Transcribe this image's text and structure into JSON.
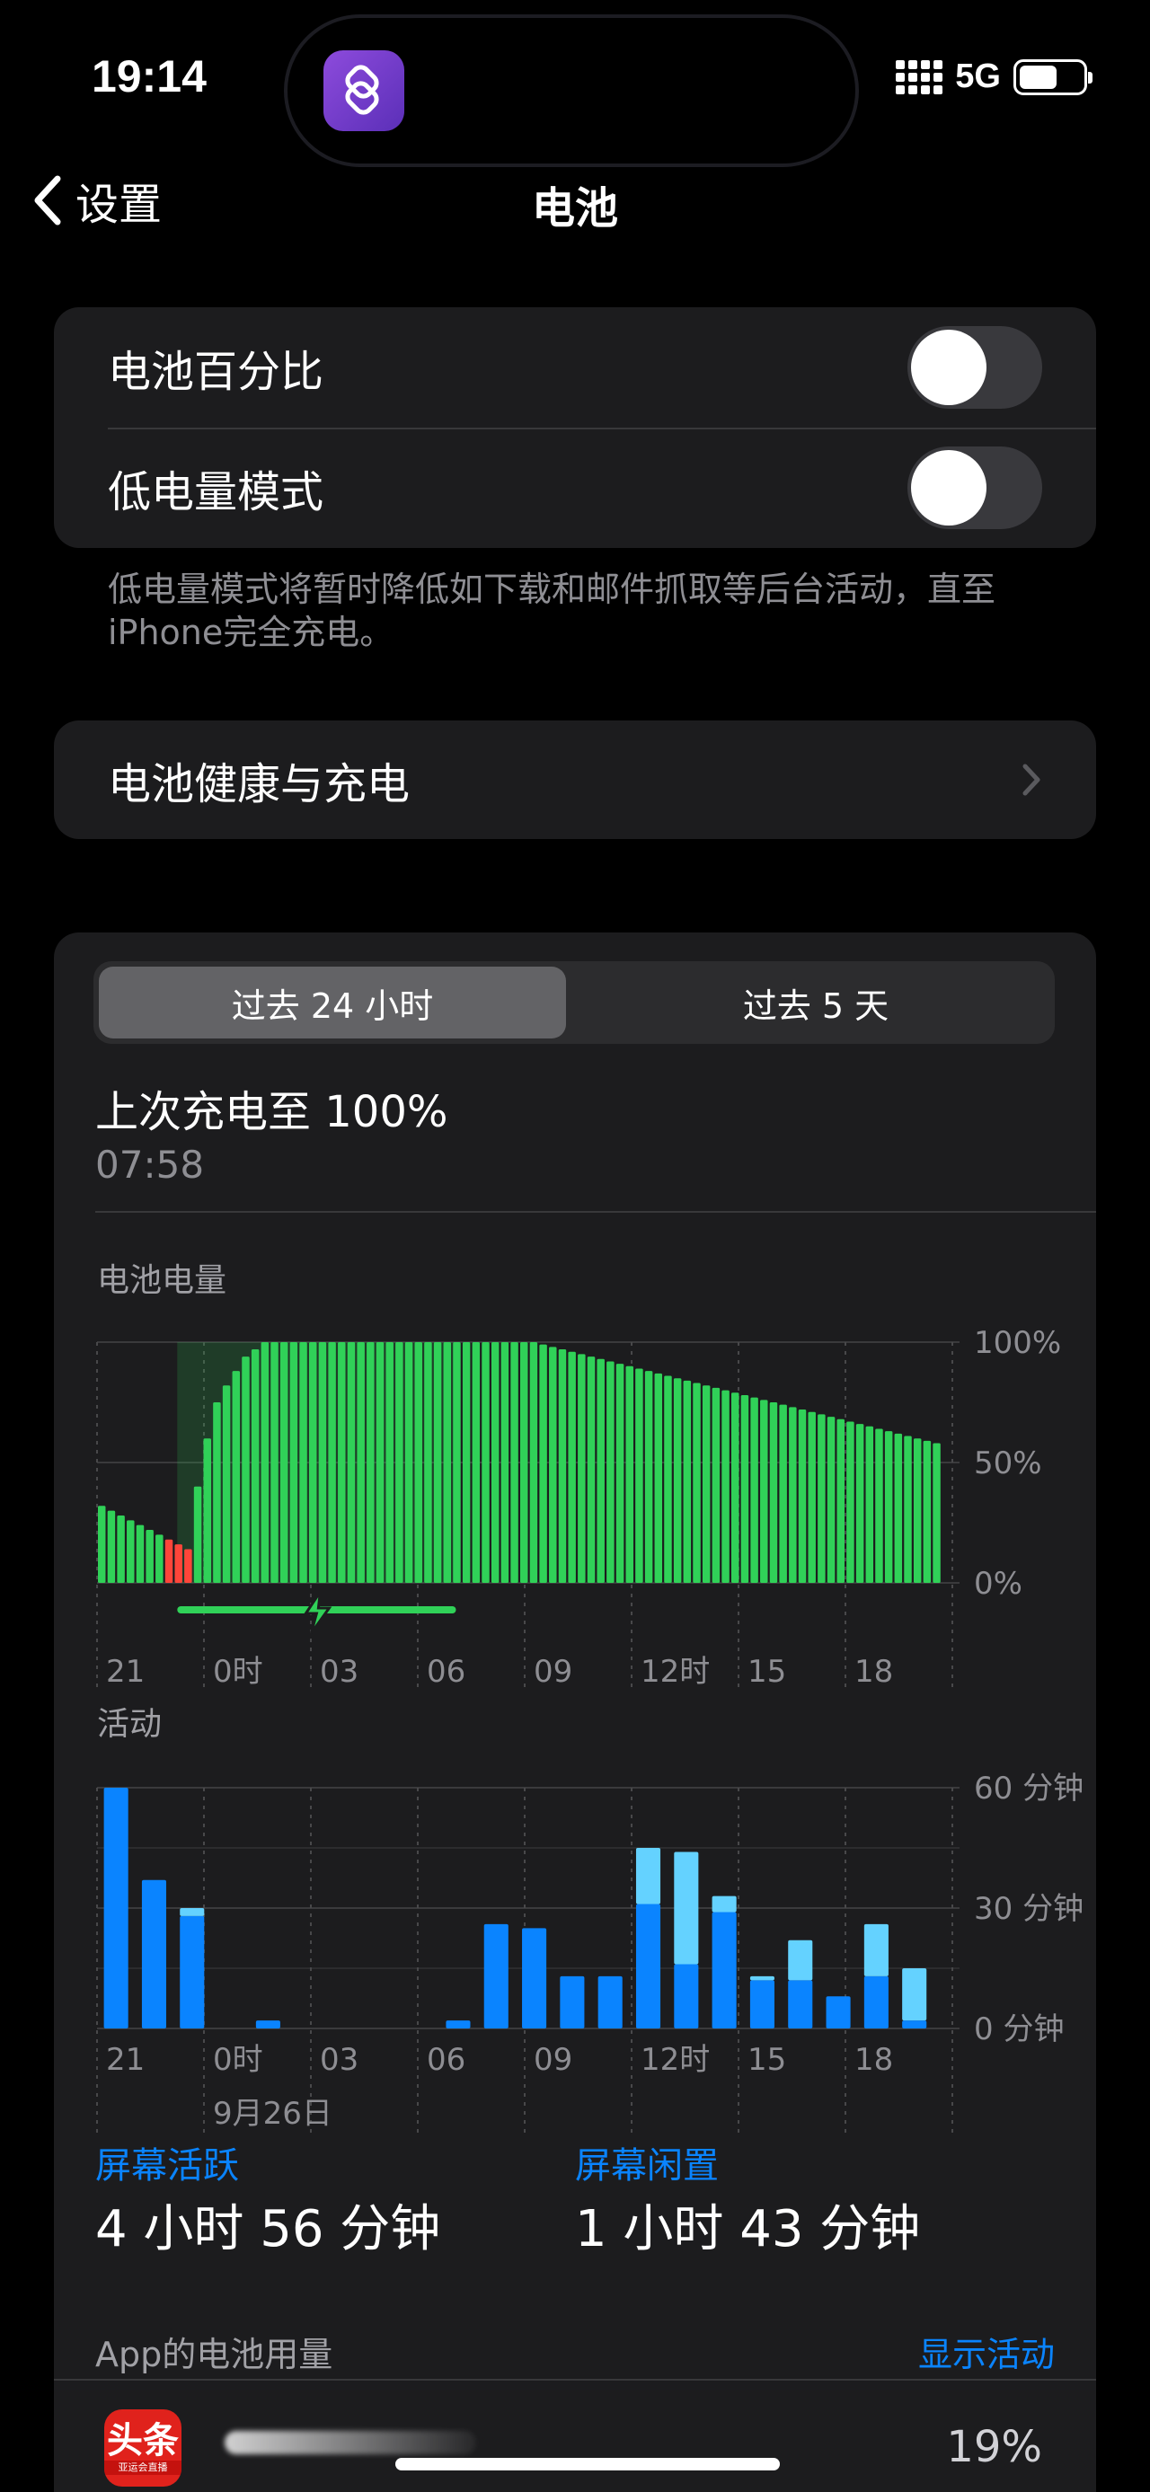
{
  "status_bar": {
    "time": "19:14",
    "network": "5G",
    "battery_level": 0.6
  },
  "nav": {
    "back_label": "设置",
    "title": "电池"
  },
  "settings": {
    "battery_percentage_label": "电池百分比",
    "battery_percentage_on": false,
    "low_power_label": "低电量模式",
    "low_power_on": false,
    "low_power_footnote": "低电量模式将暂时降低如下载和邮件抓取等后台活动，直至iPhone完全充电。",
    "health_label": "电池健康与充电"
  },
  "usage": {
    "segment_24h": "过去 24 小时",
    "segment_5d": "过去 5 天",
    "selected_segment": "过去 24 小时",
    "last_charged_title": "上次充电至 100%",
    "last_charged_time": "07:58",
    "battery_chart_label": "电池电量",
    "activity_chart_label": "活动",
    "date_label": "9月26日",
    "screen_on_label": "屏幕活跃",
    "screen_on_value": "4 小时 56 分钟",
    "screen_off_label": "屏幕闲置",
    "screen_off_value": "1 小时 43 分钟",
    "app_usage_label": "App的电池用量",
    "show_activity_label": "显示活动",
    "apps": [
      {
        "icon_text": "头条",
        "icon_subtext": "亚运会直播",
        "percent": "19%"
      }
    ]
  },
  "colors": {
    "battery_green": "#30d158",
    "battery_red": "#ff453a",
    "activity_on": "#0a84ff",
    "activity_off": "#64d2ff",
    "link_blue": "#0a84ff"
  },
  "chart_data": [
    {
      "type": "bar",
      "title": "电池电量",
      "x_tick_labels": [
        "21",
        "0时",
        "03",
        "06",
        "09",
        "12时",
        "15",
        "18"
      ],
      "y_tick_labels": [
        "100%",
        "50%",
        "0%"
      ],
      "ylim": [
        0,
        100
      ],
      "series": [
        {
          "values": [
            32,
            30,
            28,
            26,
            24,
            22,
            20,
            18,
            16,
            14,
            40,
            60,
            75,
            82,
            88,
            94,
            97,
            100,
            100,
            100,
            100,
            100,
            100,
            100,
            100,
            100,
            100,
            100,
            100,
            100,
            100,
            100,
            100,
            100,
            100,
            100,
            100,
            100,
            100,
            100,
            100,
            100,
            100,
            100,
            100,
            100,
            99,
            98,
            97,
            96,
            95,
            94,
            93,
            92,
            91,
            90,
            89,
            88,
            87,
            86,
            85,
            84,
            83,
            82,
            81,
            80,
            79,
            78,
            77,
            76,
            75,
            74,
            73,
            72,
            71,
            70,
            69,
            68,
            67,
            66,
            65,
            64,
            63,
            62,
            61,
            60,
            59,
            58
          ],
          "low_threshold_first_index": 7
        }
      ],
      "charging_range_fraction": [
        0.095,
        0.425
      ]
    },
    {
      "type": "bar",
      "title": "活动",
      "x_tick_labels": [
        "21",
        "0时",
        "03",
        "06",
        "09",
        "12时",
        "15",
        "18"
      ],
      "y_tick_labels": [
        "60 分钟",
        "30 分钟",
        "0 分钟"
      ],
      "ylim": [
        0,
        60
      ],
      "series": [
        {
          "name": "屏幕活跃",
          "values": [
            60,
            37,
            28,
            0,
            2,
            0,
            0,
            0,
            0,
            2,
            26,
            25,
            13,
            13,
            31,
            16,
            29,
            12,
            12,
            8,
            13,
            2
          ]
        },
        {
          "name": "屏幕闲置",
          "values": [
            0,
            0,
            2,
            0,
            0,
            0,
            0,
            0,
            0,
            0,
            0,
            0,
            0,
            0,
            14,
            28,
            4,
            1,
            10,
            0,
            13,
            13
          ]
        }
      ]
    }
  ]
}
